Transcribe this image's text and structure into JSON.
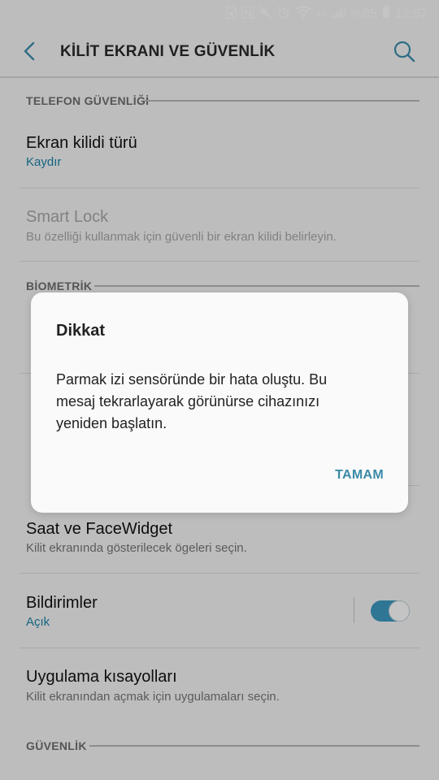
{
  "status_bar": {
    "battery": "%85",
    "time": "12:57",
    "network": "4G",
    "icons": [
      "sim-icon",
      "nfc-icon",
      "mute-icon",
      "alarm-icon",
      "wifi-icon",
      "signal-icon",
      "battery-icon"
    ]
  },
  "appbar": {
    "title": "KİLİT EKRANI VE GÜVENLİK"
  },
  "sections": {
    "phone_security": "TELEFON GÜVENLİĞİ",
    "biometric": "BİOMETRİK",
    "security": "GÜVENLİK"
  },
  "items": {
    "screen_lock": {
      "title": "Ekran kilidi türü",
      "subtitle": "Kaydır"
    },
    "smart_lock": {
      "title": "Smart Lock",
      "subtitle": "Bu özelliği kullanmak için güvenli bir ekran kilidi belirleyin."
    },
    "clock_facewidget": {
      "title": "Saat ve FaceWidget",
      "subtitle": "Kilit ekranında gösterilecek ögeleri seçin."
    },
    "notifications": {
      "title": "Bildirimler",
      "subtitle": "Açık",
      "toggle_on": true
    },
    "app_shortcuts": {
      "title": "Uygulama kısayolları",
      "subtitle": "Kilit ekranından açmak için uygulamaları seçin."
    }
  },
  "dialog": {
    "title": "Dikkat",
    "message": "Parmak izi sensöründe bir hata oluştu. Bu mesaj tekrarlayarak görünürse cihazınızı yeniden başlatın.",
    "button": "TAMAM"
  },
  "colors": {
    "accent": "#1a84a8",
    "toggle": "#3c9ac0",
    "dialog_button": "#3a8aa8"
  }
}
